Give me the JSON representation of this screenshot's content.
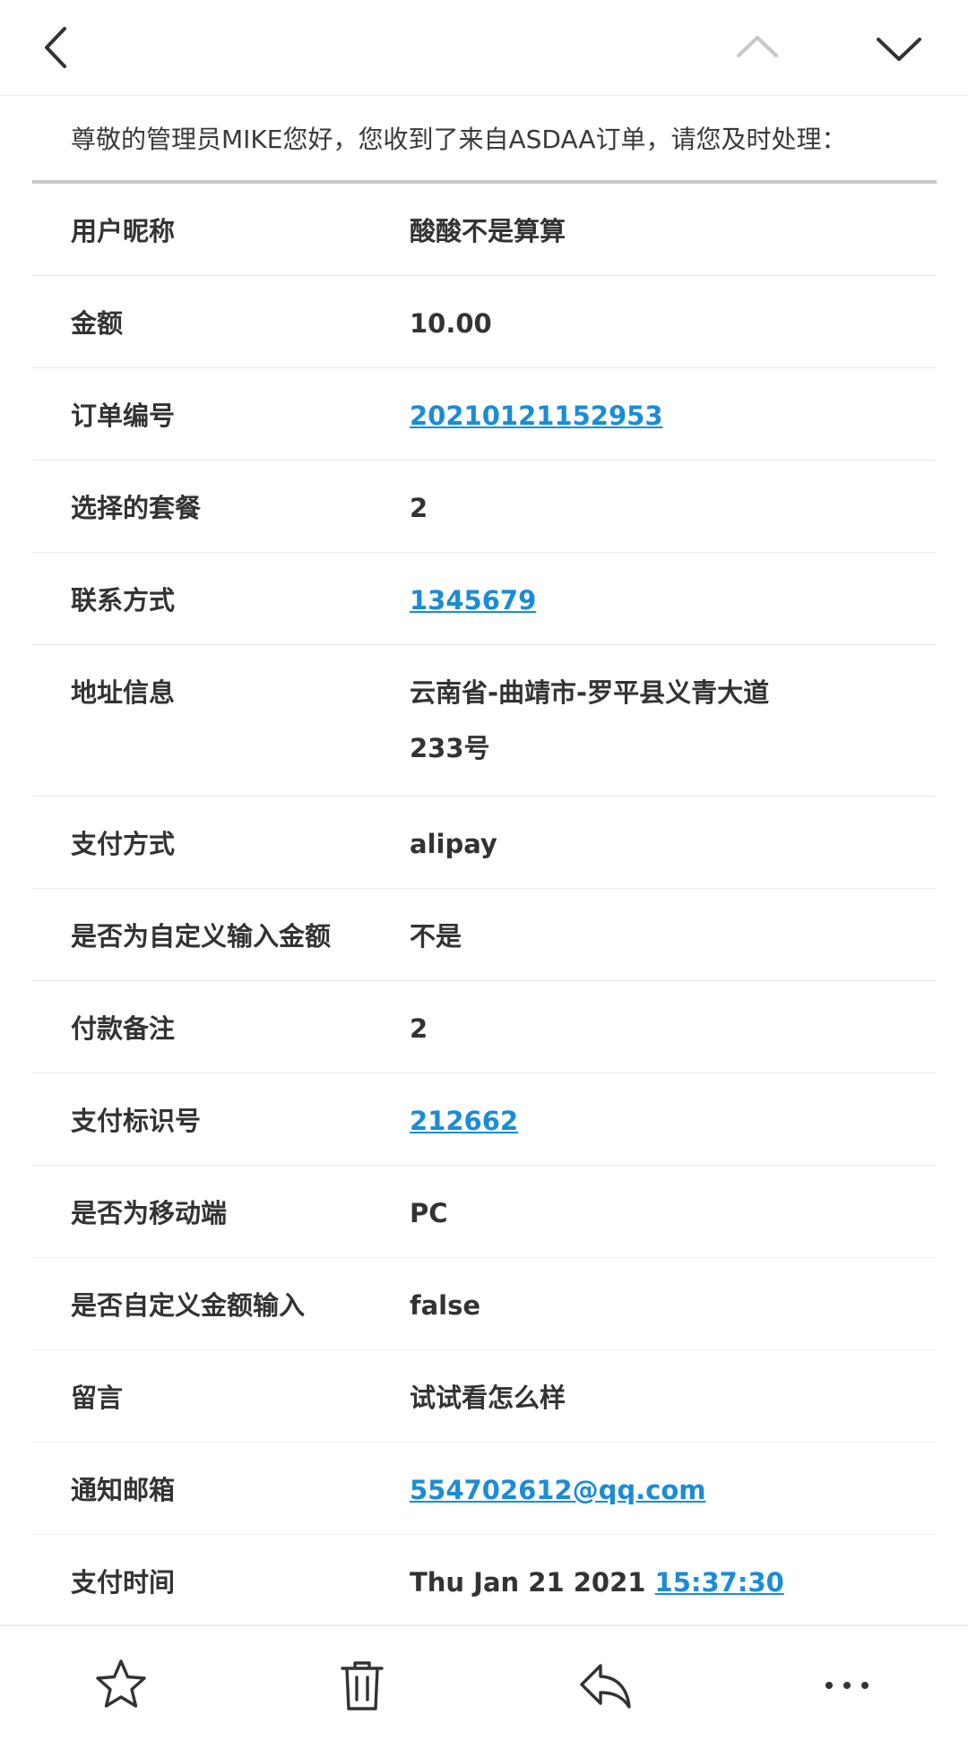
{
  "toolbar": {
    "back_icon": "chevron-left-icon",
    "prev_icon": "chevron-up-icon",
    "next_icon": "chevron-down-icon"
  },
  "greeting": "尊敬的管理员MIKE您好，您收到了来自ASDAA订单，请您及时处理：",
  "order": {
    "nickname_label": "用户昵称",
    "nickname": "酸酸不是算算",
    "amount_label": "金额",
    "amount": "10.00",
    "order_no_label": "订单编号",
    "order_no": "20210121152953",
    "package_label": "选择的套餐",
    "package": "2",
    "contact_label": "联系方式",
    "contact": "1345679",
    "address_label": "地址信息",
    "address": "云南省-曲靖市-罗平县义青大道\n233号",
    "pay_method_label": "支付方式",
    "pay_method": "alipay",
    "custom_amount_label": "是否为自定义输入金额",
    "custom_amount": "不是",
    "pay_note_label": "付款备注",
    "pay_note": "2",
    "pay_id_label": "支付标识号",
    "pay_id": "212662",
    "mobile_label": "是否为移动端",
    "mobile": "PC",
    "custom_input_label": "是否自定义金额输入",
    "custom_input": "false",
    "message_label": "留言",
    "message": "试试看怎么样",
    "email_label": "通知邮箱",
    "email": "554702612@qq.com",
    "pay_time_label": "支付时间",
    "pay_time_date": "Thu Jan 21 2021",
    "pay_time_clock": "15:37:30"
  },
  "bottom_bar": {
    "star_icon": "star-icon",
    "trash_icon": "trash-icon",
    "reply_icon": "reply-icon",
    "more_icon": "more-icon"
  },
  "colors": {
    "link": "#1a8cd8",
    "text": "#333333",
    "icon": "#333333",
    "icon_disabled": "#c8c8c8",
    "divider": "#ececec",
    "header_rule": "#c6c6c6"
  }
}
